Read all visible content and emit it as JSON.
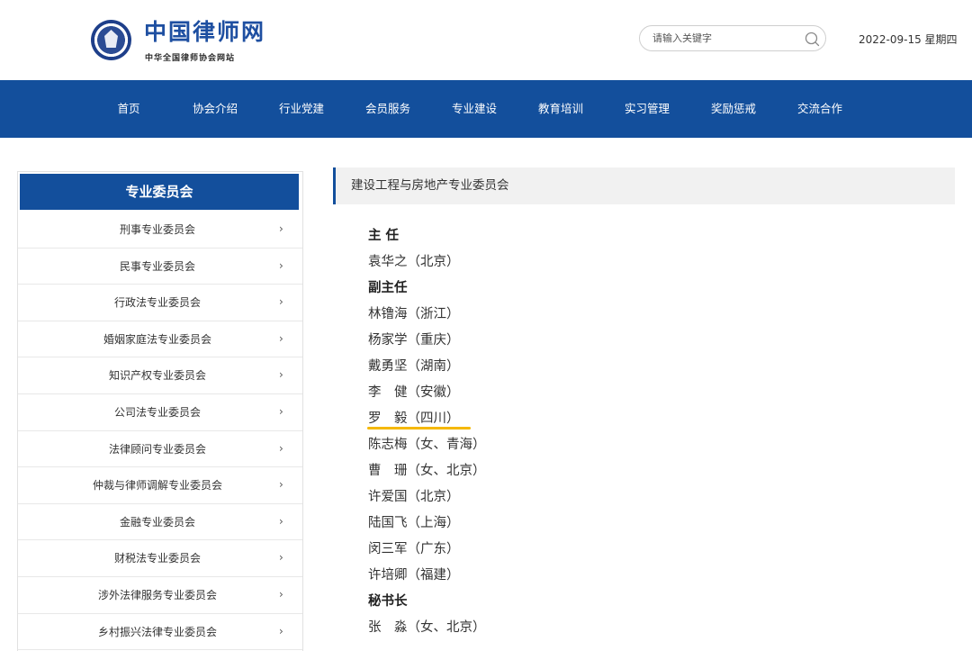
{
  "header": {
    "logo_title": "中国律师网",
    "logo_subtitle": "中华全国律师协会网站",
    "search_placeholder": "请输入关键字",
    "date": "2022-09-15 星期四"
  },
  "nav": {
    "items": [
      "首页",
      "协会介绍",
      "行业党建",
      "会员服务",
      "专业建设",
      "教育培训",
      "实习管理",
      "奖励惩戒",
      "交流合作"
    ]
  },
  "sidebar": {
    "title": "专业委员会",
    "chevron": "›",
    "items": [
      "刑事专业委员会",
      "民事专业委员会",
      "行政法专业委员会",
      "婚姻家庭法专业委员会",
      "知识产权专业委员会",
      "公司法专业委员会",
      "法律顾问专业委员会",
      "仲裁与律师调解专业委员会",
      "金融专业委员会",
      "财税法专业委员会",
      "涉外法律服务专业委员会",
      "乡村振兴法律专业委员会"
    ]
  },
  "main": {
    "breadcrumb": "建设工程与房地产专业委员会",
    "roster": [
      "主 任",
      "袁华之（北京）",
      "副主任",
      "林镥海（浙江）",
      "杨家学（重庆）",
      "戴勇坚（湖南）",
      "李　健（安徽）",
      "罗　毅（四川）",
      "陈志梅（女、青海）",
      "曹　珊（女、北京）",
      "许爱国（北京）",
      "陆国飞（上海）",
      "闵三军（广东）",
      "许培卿（福建）",
      "秘书长",
      "张　淼（女、北京）"
    ]
  },
  "colors": {
    "brand_blue": "#134f9c",
    "highlight_underline": "#f5b800"
  }
}
